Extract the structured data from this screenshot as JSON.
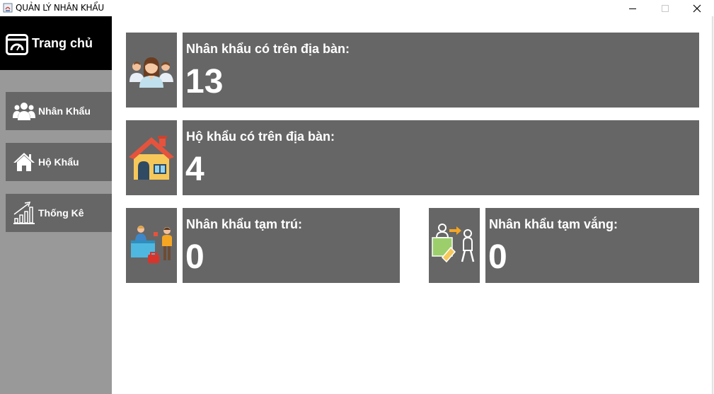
{
  "window": {
    "title": "QUẢN LÝ NHÂN KHẨU"
  },
  "sidebar": {
    "home_label": "Trang chủ",
    "items": [
      {
        "label": "Nhân Khẩu",
        "icon": "users-icon"
      },
      {
        "label": "Hộ Khẩu",
        "icon": "house-icon"
      },
      {
        "label": "Thống Kê",
        "icon": "bar-chart-icon"
      }
    ]
  },
  "cards": [
    {
      "label": "Nhân khẩu có trên địa bàn:",
      "value": "13",
      "icon": "people-group-icon"
    },
    {
      "label": "Hộ khẩu có trên địa bàn:",
      "value": "4",
      "icon": "house-icon"
    },
    {
      "label": "Nhân khẩu tạm trú:",
      "value": "0",
      "icon": "reception-icon"
    },
    {
      "label": "Nhân khẩu tạm vắng:",
      "value": "0",
      "icon": "traveler-icon"
    }
  ],
  "colors": {
    "sidebar_bg": "#999999",
    "nav_bg": "#666666",
    "card_bg": "#666666",
    "home_bg": "#000000"
  }
}
